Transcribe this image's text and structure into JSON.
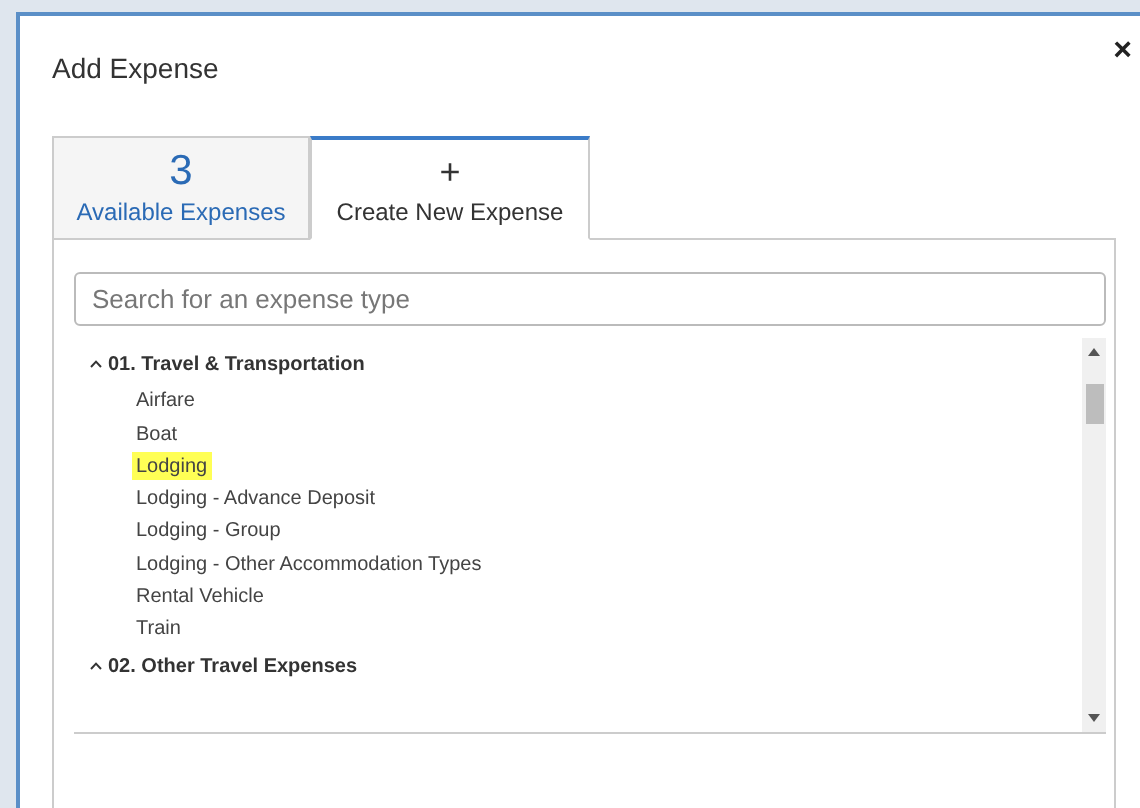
{
  "dialog": {
    "title": "Add Expense",
    "close": "×"
  },
  "tabs": [
    {
      "kind": "count",
      "count": "3",
      "label": "Available Expenses",
      "selected": false
    },
    {
      "kind": "create",
      "count": "+",
      "label": "Create New Expense",
      "selected": true
    }
  ],
  "search": {
    "placeholder": "Search for an expense type"
  },
  "groups": [
    {
      "label": "01. Travel & Transportation",
      "expanded": true,
      "children": [
        {
          "label": "Airfare",
          "highlighted": false
        },
        {
          "label": "Boat",
          "highlighted": false
        },
        {
          "label": "Lodging",
          "highlighted": true
        },
        {
          "label": "Lodging - Advance Deposit",
          "highlighted": false
        },
        {
          "label": "Lodging - Group",
          "highlighted": false
        },
        {
          "label": "Lodging - Other Accommodation Types",
          "highlighted": false
        },
        {
          "label": "Rental Vehicle",
          "highlighted": false
        },
        {
          "label": "Train",
          "highlighted": false
        }
      ]
    },
    {
      "label": "02. Other Travel Expenses",
      "expanded": true
    }
  ]
}
